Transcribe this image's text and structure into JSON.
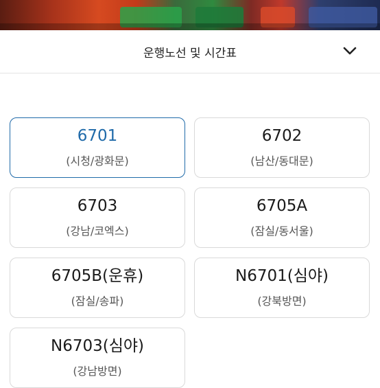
{
  "dropdown": {
    "title": "운행노선 및 시간표",
    "icon": "chevron-down-icon"
  },
  "routes": [
    {
      "number": "6701",
      "area": "(시청/광화문)",
      "selected": true
    },
    {
      "number": "6702",
      "area": "(남산/동대문)",
      "selected": false
    },
    {
      "number": "6703",
      "area": "(강남/코엑스)",
      "selected": false
    },
    {
      "number": "6705A",
      "area": "(잠실/동서울)",
      "selected": false
    },
    {
      "number": "6705B(운휴)",
      "area": "(잠실/송파)",
      "selected": false
    },
    {
      "number": "N6701(심야)",
      "area": "(강북방면)",
      "selected": false
    },
    {
      "number": "N6703(심야)",
      "area": "(강남방면)",
      "selected": false
    }
  ],
  "colors": {
    "accent": "#1f6aa9",
    "border": "#d9d9d9"
  }
}
